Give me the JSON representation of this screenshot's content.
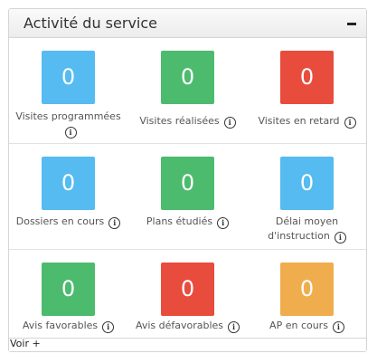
{
  "panel": {
    "title": "Activité du service",
    "collapse_icon": "minus-icon",
    "footer_link": "Voir +"
  },
  "colors": {
    "blue": "#55bbf0",
    "green": "#4cbb6e",
    "red": "#e84c3d",
    "orange": "#f0ad4e"
  },
  "info_icon": "info-icon",
  "tiles": [
    {
      "value": "0",
      "label_a": "Visites programmées",
      "label_b": "",
      "color": "blue"
    },
    {
      "value": "0",
      "label_a": "Visites réalisées",
      "label_b": "",
      "color": "green"
    },
    {
      "value": "0",
      "label_a": "Visites en retard",
      "label_b": "",
      "color": "red"
    },
    {
      "value": "0",
      "label_a": "Dossiers en cours",
      "label_b": "",
      "color": "blue"
    },
    {
      "value": "0",
      "label_a": "Plans étudiés",
      "label_b": "",
      "color": "green"
    },
    {
      "value": "0",
      "label_a": "Délai moyen",
      "label_b": "d'instruction",
      "color": "blue"
    },
    {
      "value": "0",
      "label_a": "Avis favorables",
      "label_b": "",
      "color": "green"
    },
    {
      "value": "0",
      "label_a": "Avis défavorables",
      "label_b": "",
      "color": "red"
    },
    {
      "value": "0",
      "label_a": "AP en cours",
      "label_b": "",
      "color": "orange"
    }
  ]
}
